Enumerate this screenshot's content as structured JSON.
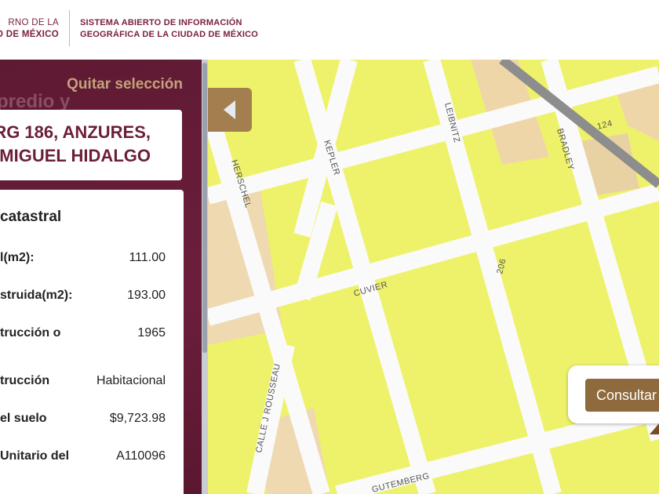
{
  "header": {
    "gov_line1": "RNO DE LA",
    "gov_line2": "D DE MÉXICO",
    "system_line1": "SISTEMA ABIERTO DE INFORMACIÓN",
    "system_line2": "GEOGRÁFICA DE LA CIUDAD DE MÉXICO"
  },
  "panel": {
    "clear_selection": "Quitar selección",
    "section_title_ghost": "predio y",
    "address_line1": "RG 186, ANZURES,",
    "address_line2": "MIGUEL HIDALGO",
    "card_title": "catastral",
    "rows": [
      {
        "label": "l(m2):",
        "value": "111.00"
      },
      {
        "label": "struida(m2):",
        "value": "193.00"
      },
      {
        "label": "trucción o",
        "value": "1965"
      },
      {
        "label": "trucción",
        "value": "Habitacional"
      },
      {
        "label": "el suelo",
        "value": "$9,723.98"
      },
      {
        "label": "Unitario del",
        "value": "A110096"
      }
    ]
  },
  "map": {
    "streets": [
      "HERSCHEL",
      "KEPLER",
      "LEIBNITZ",
      "BRADLEY",
      "CUVIER",
      "CALLE J ROUSSEAU",
      "GUTEMBERG",
      "124",
      "206"
    ],
    "collapse_icon": "triangle-left",
    "popup_button": "Consultar"
  },
  "colors": {
    "brand": "#6b1e3b",
    "accent": "#a37f4f",
    "parcel": "#eef26a"
  }
}
